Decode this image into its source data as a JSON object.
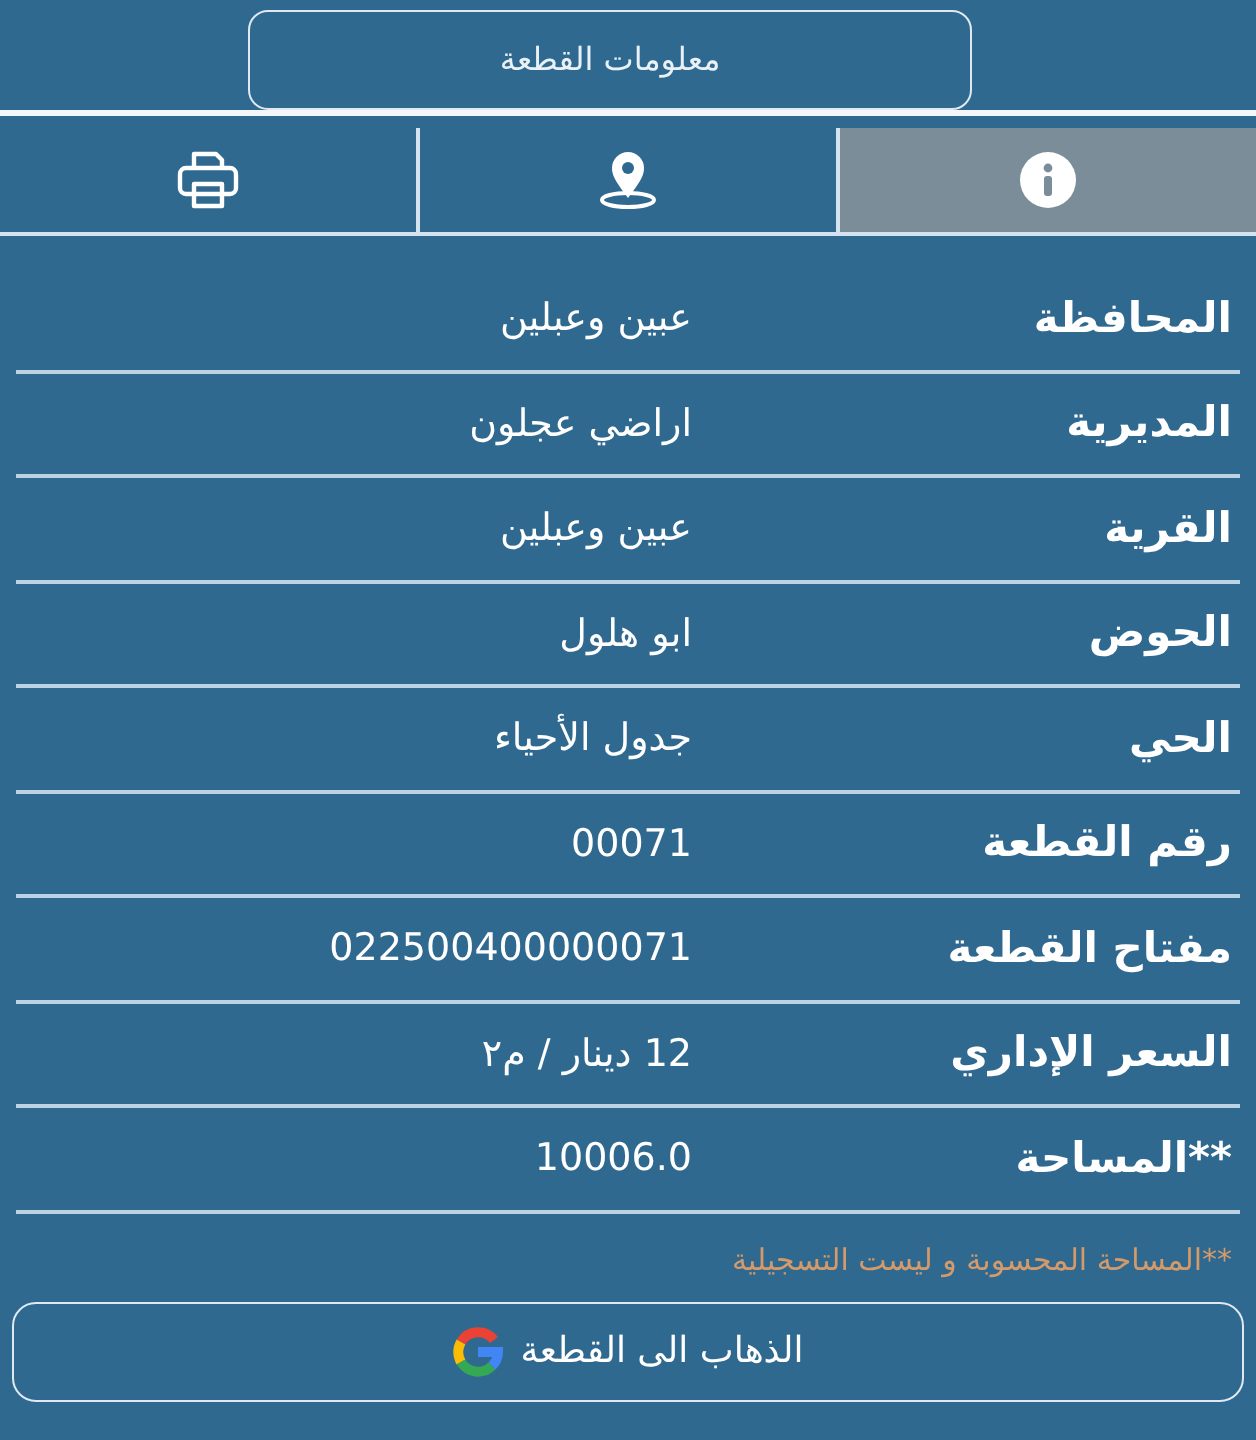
{
  "header": {
    "title": "معلومات القطعة"
  },
  "tabs": [
    {
      "kind": "info",
      "selected": true
    },
    {
      "kind": "location",
      "selected": false
    },
    {
      "kind": "print",
      "selected": false
    }
  ],
  "fields": [
    {
      "label": "المحافظة",
      "value": "عبين وعبلين"
    },
    {
      "label": "المديرية",
      "value": "اراضي عجلون"
    },
    {
      "label": "القرية",
      "value": "عبين وعبلين"
    },
    {
      "label": "الحوض",
      "value": "ابو هلول"
    },
    {
      "label": "الحي",
      "value": "جدول الأحياء"
    },
    {
      "label": "رقم القطعة",
      "value": "00071"
    },
    {
      "label": "مفتاح القطعة",
      "value": "022500400000071"
    },
    {
      "label": "السعر الإداري",
      "value": "12 دينار / م٢"
    },
    {
      "label": "**المساحة",
      "value": "10006.0"
    }
  ],
  "note": "**المساحة المحسوبة و ليست التسجيلية",
  "go_button": {
    "label": "الذهاب الى القطعة"
  }
}
